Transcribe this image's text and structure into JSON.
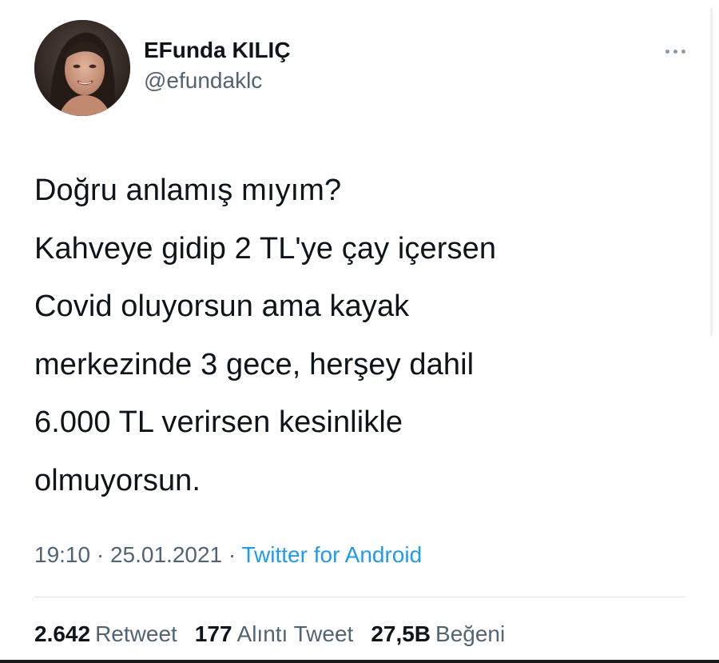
{
  "user": {
    "display_name": "EFunda KILIÇ",
    "handle": "@efundaklc"
  },
  "tweet": {
    "lines": [
      "Doğru anlamış mıyım?",
      "Kahveye gidip 2 TL'ye çay içersen",
      "Covid oluyorsun ama kayak",
      "merkezinde 3 gece, herşey dahil",
      "6.000 TL verirsen kesinlikle",
      "olmuyorsun."
    ],
    "time": "19:10",
    "separator": "·",
    "date": "25.01.2021",
    "source": "Twitter for Android"
  },
  "stats": {
    "retweets": {
      "count": "2.642",
      "label": "Retweet"
    },
    "quotes": {
      "count": "177",
      "label": "Alıntı Tweet"
    },
    "likes": {
      "count": "27,5B",
      "label": "Beğeni"
    }
  },
  "icons": {
    "more": "more-dots-icon"
  },
  "colors": {
    "text": "#0f1419",
    "secondary": "#536471",
    "link": "#1d9bf0"
  }
}
